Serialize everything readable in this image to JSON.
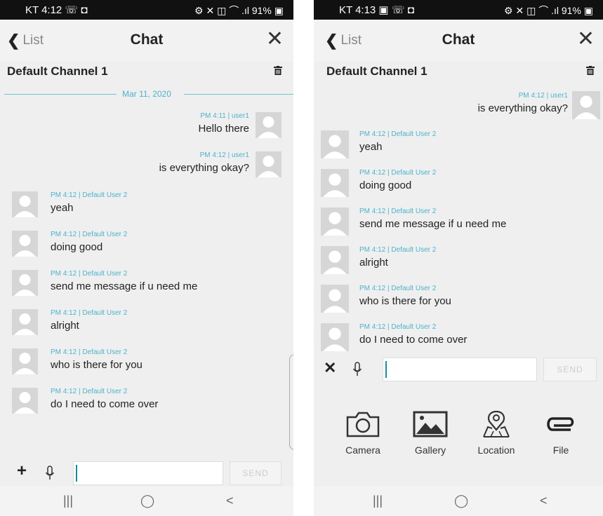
{
  "left_screen": {
    "status": {
      "left": "KT 4:12 ☏ ◘",
      "right": "⚙ ✕ ◫ ⌒ .ıl 91% ▣"
    },
    "header": {
      "back_label": "List",
      "title": "Chat"
    },
    "channel_name": "Default Channel 1",
    "date_separator": "Mar 11, 2020",
    "outgoing": [
      {
        "meta": "PM 4:11 | user1",
        "text": "Hello there"
      },
      {
        "meta": "PM 4:12 | user1",
        "text": "is everything okay?"
      }
    ],
    "incoming": [
      {
        "meta": "PM 4:12 | Default User 2",
        "text": "yeah"
      },
      {
        "meta": "PM 4:12 | Default User 2",
        "text": "doing good"
      },
      {
        "meta": "PM 4:12 | Default User 2",
        "text": "send me message if u need me"
      },
      {
        "meta": "PM 4:12 | Default User 2",
        "text": "alright"
      },
      {
        "meta": "PM 4:12 | Default User 2",
        "text": "who is there for you"
      },
      {
        "meta": "PM 4:12 | Default User 2",
        "text": "do I need to come over"
      }
    ],
    "input": {
      "send_label": "SEND"
    }
  },
  "right_screen": {
    "status": {
      "left": "KT 4:13 ▣ ☏ ◘",
      "right": "⚙ ✕ ◫ ⌒ .ıl 91% ▣"
    },
    "header": {
      "back_label": "List",
      "title": "Chat"
    },
    "channel_name": "Default Channel 1",
    "outgoing": [
      {
        "meta": "PM 4:12 | user1",
        "text": "is everything okay?"
      }
    ],
    "incoming": [
      {
        "meta": "PM 4:12 | Default User 2",
        "text": "yeah"
      },
      {
        "meta": "PM 4:12 | Default User 2",
        "text": "doing good"
      },
      {
        "meta": "PM 4:12 | Default User 2",
        "text": "send me message if u need me"
      },
      {
        "meta": "PM 4:12 | Default User 2",
        "text": "alright"
      },
      {
        "meta": "PM 4:12 | Default User 2",
        "text": "who is there for you"
      },
      {
        "meta": "PM 4:12 | Default User 2",
        "text": "do I need to come over"
      }
    ],
    "input": {
      "send_label": "SEND"
    },
    "attachments": [
      {
        "label": "Camera",
        "icon": "camera-icon"
      },
      {
        "label": "Gallery",
        "icon": "gallery-icon"
      },
      {
        "label": "Location",
        "icon": "location-icon"
      },
      {
        "label": "File",
        "icon": "paperclip-icon"
      }
    ]
  },
  "nav": {
    "recent": "|||",
    "home": "◯",
    "back": "<"
  },
  "colors": {
    "accent": "#4db3cc",
    "background": "#efefef",
    "statusbar": "#111111"
  }
}
